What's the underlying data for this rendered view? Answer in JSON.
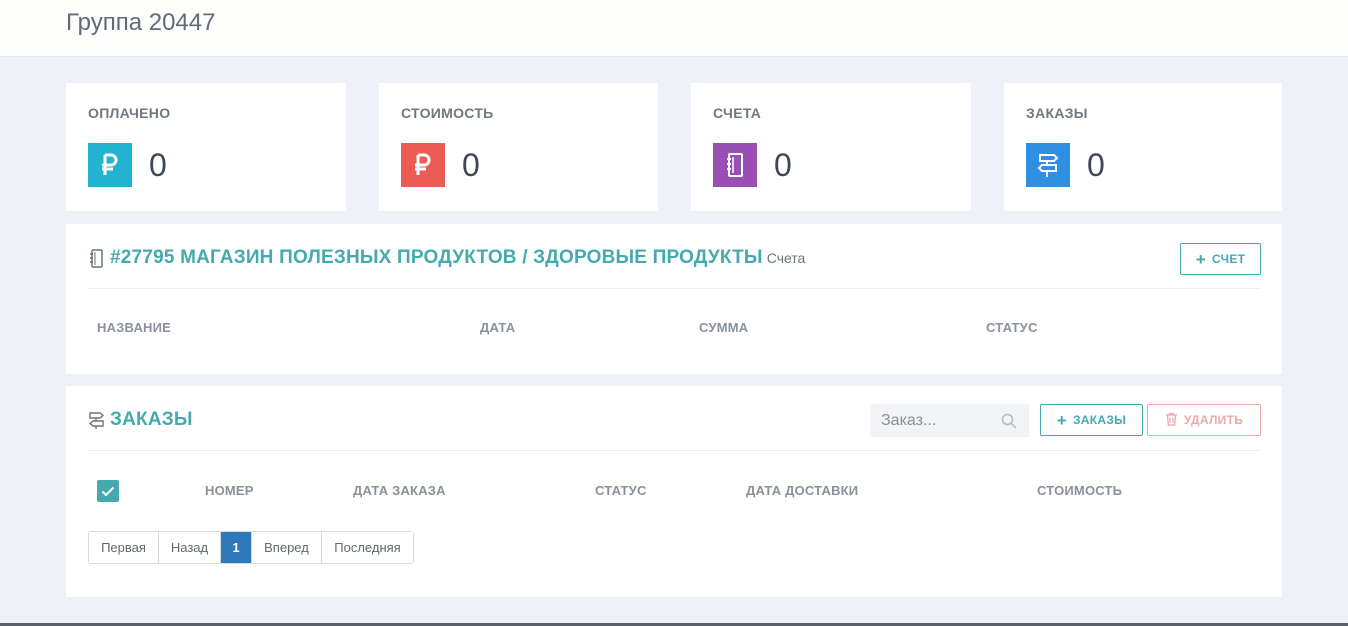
{
  "page": {
    "title": "Группа 20447"
  },
  "stats": [
    {
      "label": "ОПЛАЧЕНО",
      "value": "0",
      "icon": "ruble-icon",
      "color": "#22b2d2"
    },
    {
      "label": "СТОИМОСТЬ",
      "value": "0",
      "icon": "ruble-icon",
      "color": "#ec5b55"
    },
    {
      "label": "СЧЕТА",
      "value": "0",
      "icon": "notebook-icon",
      "color": "#9a4fb5"
    },
    {
      "label": "ЗАКАЗЫ",
      "value": "0",
      "icon": "signpost-icon",
      "color": "#2f8fe2"
    }
  ],
  "invoices": {
    "title": "#27795 МАГАЗИН ПОЛЕЗНЫХ ПРОДУКТОВ / ЗДОРОВЫЕ ПРОДУКТЫ",
    "subtitle": "Счета",
    "icon": "notebook-icon",
    "add_button": "СЧЕТ",
    "columns": [
      "НАЗВАНИЕ",
      "ДАТА",
      "СУММА",
      "СТАТУС"
    ]
  },
  "orders": {
    "title": "ЗАКАЗЫ",
    "icon": "signpost-icon",
    "search_placeholder": "Заказ...",
    "add_button": "ЗАКАЗЫ",
    "delete_button": "УДАЛИТЬ",
    "columns": [
      "НОМЕР",
      "ДАТА ЗАКАЗА",
      "СТАТУС",
      "ДАТА ДОСТАВКИ",
      "СТОИМОСТЬ"
    ],
    "select_all_checked": true,
    "pagination": {
      "first": "Первая",
      "prev": "Назад",
      "current": "1",
      "next": "Вперед",
      "last": "Последняя"
    }
  },
  "colors": {
    "accent": "#45aab0",
    "danger": "#eea8a8",
    "pager_active": "#2d78b9"
  }
}
